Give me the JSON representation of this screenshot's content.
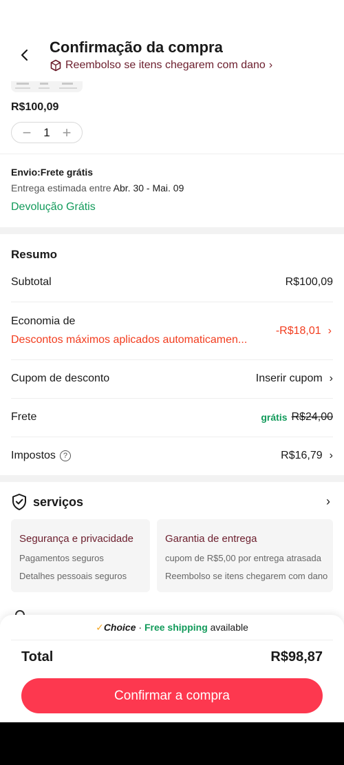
{
  "header": {
    "title": "Confirmação da compra",
    "refund_notice": "Reembolso se itens chegarem com dano",
    "chevron": "›"
  },
  "product": {
    "price": "R$100,09",
    "quantity": "1",
    "minus": "−",
    "plus": "+"
  },
  "shipping": {
    "title": "Envio:Frete grátis",
    "estimate_prefix": "Entrega estimada entre ",
    "estimate_dates": "Abr. 30 - Mai. 09",
    "free_return": "Devolução Grátis"
  },
  "summary": {
    "title": "Resumo",
    "subtotal_label": "Subtotal",
    "subtotal_value": "R$100,09",
    "savings_label": "Economia de",
    "savings_desc": "Descontos máximos aplicados automaticamen...",
    "savings_value": "-R$18,01",
    "coupon_label": "Cupom de desconto",
    "coupon_value": "Inserir cupom",
    "shipping_label": "Frete",
    "shipping_free": "grátis",
    "shipping_old": "R$24,00",
    "tax_label": "Impostos",
    "tax_help": "?",
    "tax_value": "R$16,79"
  },
  "services": {
    "title": "serviços",
    "cards": [
      {
        "title": "Segurança e privacidade",
        "items": [
          "Pagamentos seguros",
          "Detalhes pessoais seguros"
        ]
      },
      {
        "title": "Garantia de entrega",
        "items": [
          "cupom de R$5,00 por entrega atrasada",
          "Reembolso se itens chegarem com dano"
        ]
      }
    ]
  },
  "bottom": {
    "check": "✓",
    "choice": "Choice",
    "dot": " · ",
    "free_shipping": "Free shipping",
    "available": " available",
    "total_label": "Total",
    "total_value": "R$98,87",
    "confirm": "Confirmar a compra"
  },
  "colors": {
    "accent_red": "#fd384f",
    "discount_orange": "#f23c1e",
    "green": "#119a5a",
    "maroon": "#6b1d2c"
  },
  "icons": [
    "back-arrow-icon",
    "package-icon",
    "chevron-right-icon",
    "shield-check-icon",
    "help-icon"
  ]
}
